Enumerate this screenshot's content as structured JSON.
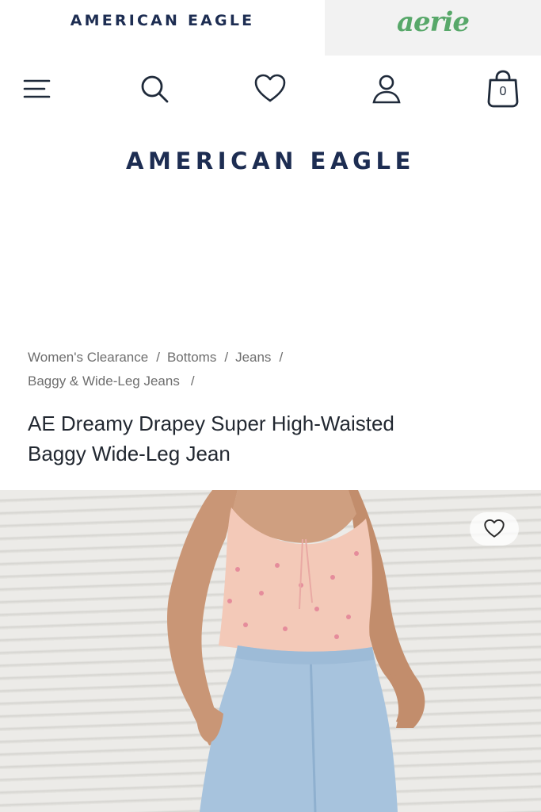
{
  "brand_switcher": {
    "american_eagle": "AMERICAN EAGLE",
    "aerie": "aerie"
  },
  "nav": {
    "icons": [
      "menu-icon",
      "search-icon",
      "heart-icon",
      "account-icon",
      "shopping-bag-icon"
    ],
    "cart_count": "0"
  },
  "logo": "AMERICAN EAGLE",
  "breadcrumb": {
    "items": [
      "Women's Clearance",
      "Bottoms",
      "Jeans",
      "Baggy & Wide-Leg Jeans"
    ],
    "separator": "/"
  },
  "product": {
    "title": "AE Dreamy Drapey Super High-Waisted Baggy Wide-Leg Jean",
    "favorite_icon": "heart-outline-icon"
  },
  "colors": {
    "brand_navy": "#1d2d52",
    "aerie_green": "#58a86a",
    "breadcrumb_gray": "#6e6e6e",
    "top_pink": "#f3c9b8",
    "denim_blue": "#a7c3dd"
  }
}
